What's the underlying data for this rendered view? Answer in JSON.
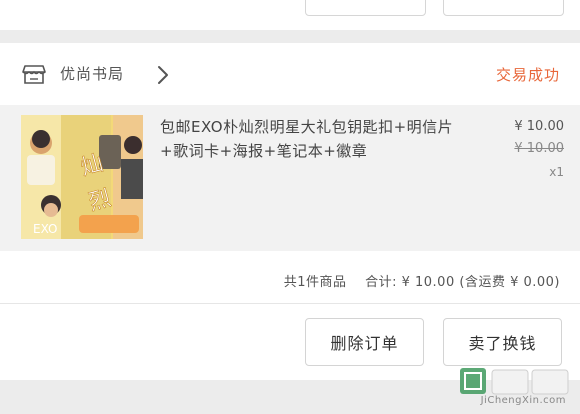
{
  "shop": {
    "name": "优尚书局",
    "status": "交易成功"
  },
  "goods": {
    "title": "包邮EXO朴灿烈明星大礼包钥匙扣+明信片+歌词卡+海报+笔记本+徽章",
    "price": "¥ 10.00",
    "original_price": "¥ 10.00",
    "quantity": "x1",
    "image_label": "EXO"
  },
  "summary": {
    "items": "共1件商品",
    "total": "合计: ¥ 10.00",
    "shipping": "(含运费 ¥ 0.00)"
  },
  "actions": {
    "delete": "删除订单",
    "sell": "卖了换钱"
  },
  "watermark": {
    "text": "JiChengXin.com"
  },
  "colors": {
    "status": "#e8673a",
    "background": "#ececec"
  },
  "icons": {
    "shop": "shop-icon",
    "chevron": "chevron-right-icon"
  }
}
